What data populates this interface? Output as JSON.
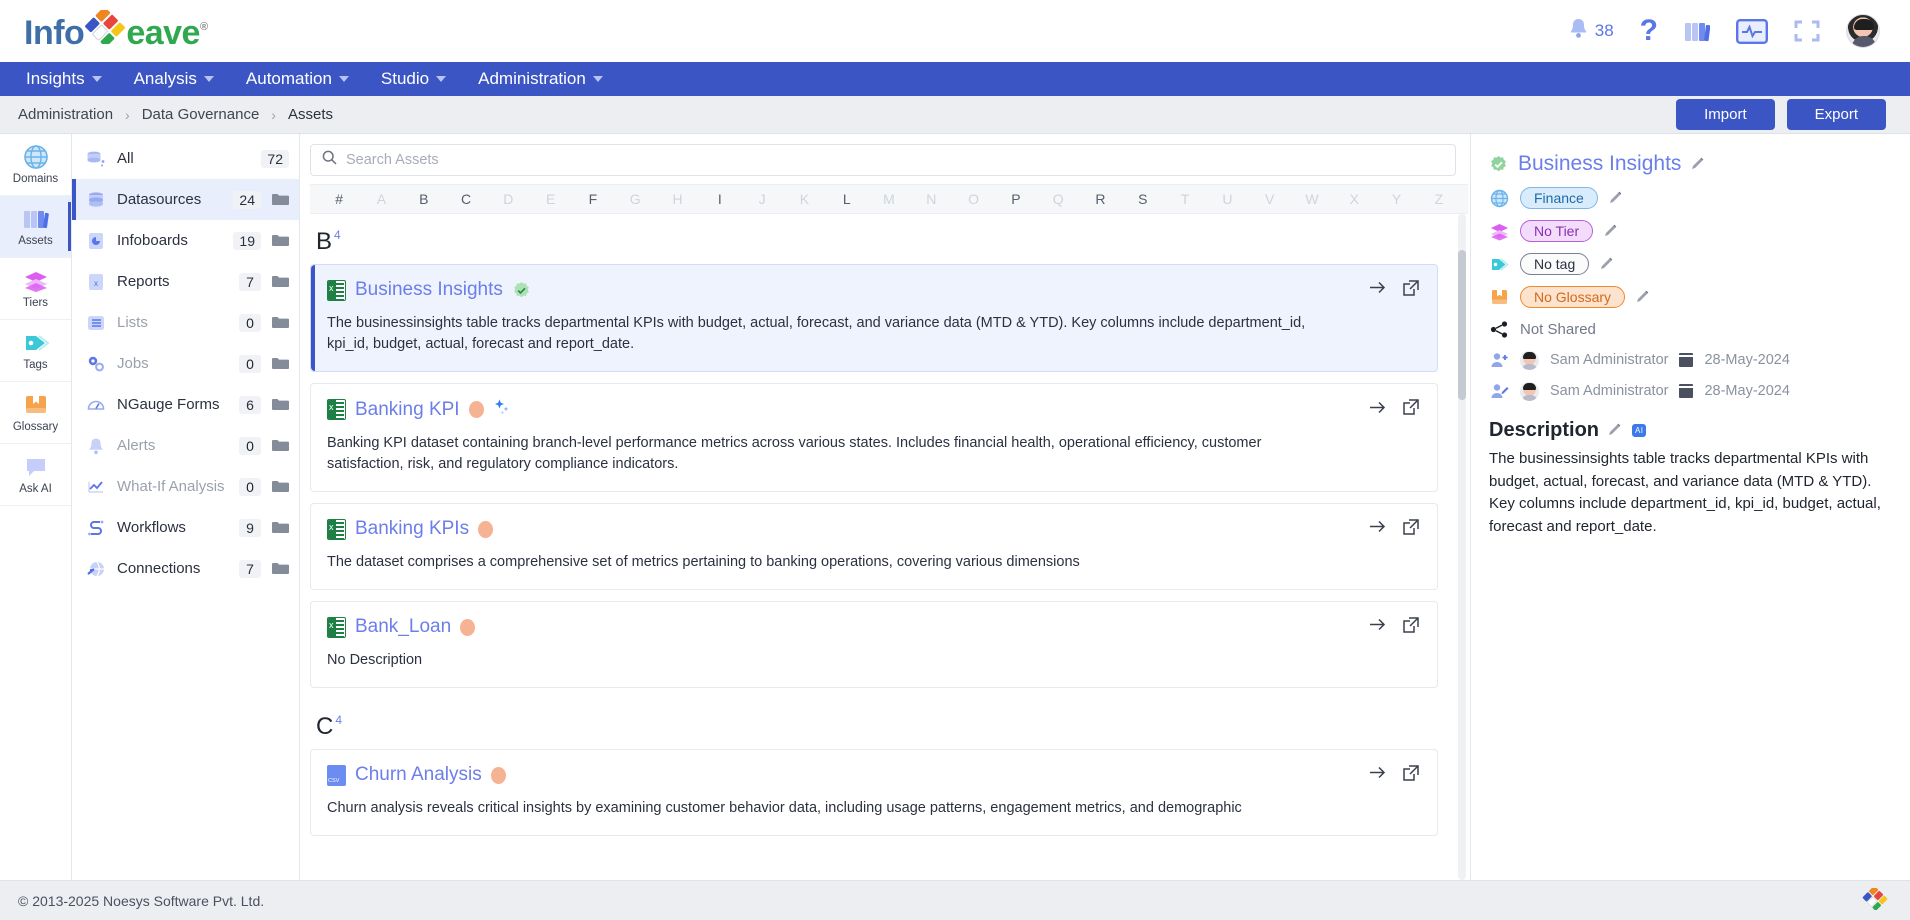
{
  "brand": {
    "name_part1": "Info",
    "name_part2": "eave",
    "reg": "®"
  },
  "header": {
    "notification_count": "38",
    "icons": [
      "bell-icon",
      "help-icon",
      "library-icon",
      "monitor-icon",
      "fullscreen-icon",
      "avatar"
    ]
  },
  "nav": [
    {
      "label": "Insights",
      "has_caret": true
    },
    {
      "label": "Analysis",
      "has_caret": true
    },
    {
      "label": "Automation",
      "has_caret": true
    },
    {
      "label": "Studio",
      "has_caret": true
    },
    {
      "label": "Administration",
      "has_caret": true
    }
  ],
  "breadcrumb": {
    "items": [
      "Administration",
      "Data Governance",
      "Assets"
    ],
    "separator": "›"
  },
  "actions": {
    "import": "Import",
    "export": "Export"
  },
  "rail": [
    {
      "label": "Domains",
      "icon": "globe-icon",
      "active": false
    },
    {
      "label": "Assets",
      "icon": "books-icon",
      "active": true
    },
    {
      "label": "Tiers",
      "icon": "layers-icon",
      "active": false
    },
    {
      "label": "Tags",
      "icon": "tag-icon",
      "active": false
    },
    {
      "label": "Glossary",
      "icon": "book-icon",
      "active": false
    },
    {
      "label": "Ask AI",
      "icon": "chat-icon",
      "active": false
    }
  ],
  "types": [
    {
      "label": "All",
      "count": "72",
      "icon": "database-all-icon",
      "active": false,
      "dim": false,
      "folder": false
    },
    {
      "label": "Datasources",
      "count": "24",
      "icon": "database-icon",
      "active": true,
      "dim": false,
      "folder": true
    },
    {
      "label": "Infoboards",
      "count": "19",
      "icon": "infoboard-icon",
      "active": false,
      "dim": false,
      "folder": true
    },
    {
      "label": "Reports",
      "count": "7",
      "icon": "report-icon",
      "active": false,
      "dim": false,
      "folder": true
    },
    {
      "label": "Lists",
      "count": "0",
      "icon": "list-icon",
      "active": false,
      "dim": true,
      "folder": true
    },
    {
      "label": "Jobs",
      "count": "0",
      "icon": "gears-icon",
      "active": false,
      "dim": true,
      "folder": true
    },
    {
      "label": "NGauge Forms",
      "count": "6",
      "icon": "gauge-icon",
      "active": false,
      "dim": false,
      "folder": true
    },
    {
      "label": "Alerts",
      "count": "0",
      "icon": "bell-icon",
      "active": false,
      "dim": true,
      "folder": true
    },
    {
      "label": "What-If Analysis",
      "count": "0",
      "icon": "trend-icon",
      "active": false,
      "dim": true,
      "folder": true
    },
    {
      "label": "Workflows",
      "count": "9",
      "icon": "workflow-icon",
      "active": false,
      "dim": false,
      "folder": true
    },
    {
      "label": "Connections",
      "count": "7",
      "icon": "connections-icon",
      "active": false,
      "dim": false,
      "folder": true
    }
  ],
  "search": {
    "placeholder": "Search Assets",
    "value": ""
  },
  "alphabet": {
    "letters": [
      "#",
      "A",
      "B",
      "C",
      "D",
      "E",
      "F",
      "G",
      "H",
      "I",
      "J",
      "K",
      "L",
      "M",
      "N",
      "O",
      "P",
      "Q",
      "R",
      "S",
      "T",
      "U",
      "V",
      "W",
      "X",
      "Y",
      "Z"
    ],
    "active": [
      "#",
      "B",
      "C",
      "F",
      "I",
      "L",
      "P",
      "R",
      "S"
    ]
  },
  "groups": [
    {
      "letter": "B",
      "count": "4",
      "assets": [
        {
          "title": "Business Insights",
          "file_icon": "excel-icon",
          "verified": true,
          "has_orange_dot": false,
          "has_ai_sparkle": false,
          "description": "The businessinsights table tracks departmental KPIs with budget, actual, forecast, and variance data (MTD & YTD). Key columns include department_id, kpi_id, budget, actual, forecast and report_date.",
          "selected": true
        },
        {
          "title": "Banking KPI",
          "file_icon": "excel-icon",
          "verified": false,
          "has_orange_dot": true,
          "has_ai_sparkle": true,
          "description": "Banking KPI dataset containing branch-level performance metrics across various states. Includes financial health, operational efficiency, customer satisfaction, risk, and regulatory compliance indicators.",
          "selected": false
        },
        {
          "title": "Banking KPIs",
          "file_icon": "excel-icon",
          "verified": false,
          "has_orange_dot": true,
          "has_ai_sparkle": false,
          "description": "The dataset comprises a comprehensive set of metrics pertaining to banking operations, covering various dimensions",
          "selected": false
        },
        {
          "title": "Bank_Loan",
          "file_icon": "excel-icon",
          "verified": false,
          "has_orange_dot": true,
          "has_ai_sparkle": false,
          "description": "No Description",
          "selected": false
        }
      ]
    },
    {
      "letter": "C",
      "count": "4",
      "assets": [
        {
          "title": "Churn Analysis",
          "file_icon": "csv-icon",
          "verified": false,
          "has_orange_dot": true,
          "has_ai_sparkle": false,
          "description": "Churn analysis reveals critical insights by examining customer behavior data, including usage patterns, engagement metrics, and demographic",
          "selected": false
        }
      ]
    }
  ],
  "detail": {
    "title": "Business Insights",
    "verified": true,
    "domain": {
      "icon": "globe-icon",
      "value": "Finance"
    },
    "tier": {
      "icon": "layers-icon",
      "value": "No Tier"
    },
    "tag": {
      "icon": "tag-icon",
      "value": "No tag"
    },
    "glossary": {
      "icon": "book-icon",
      "value": "No Glossary"
    },
    "shared": {
      "icon": "share-icon",
      "value": "Not Shared"
    },
    "created": {
      "icon": "user-add-icon",
      "user": "Sam Administrator",
      "date": "28-May-2024"
    },
    "modified": {
      "icon": "user-edit-icon",
      "user": "Sam Administrator",
      "date": "28-May-2024"
    },
    "description_heading": "Description",
    "ai_badge": "AI",
    "description": "The businessinsights table tracks departmental KPIs with budget, actual, forecast, and variance data (MTD & YTD). Key columns include department_id, kpi_id, budget, actual, forecast and report_date."
  },
  "footer": {
    "copyright": "© 2013-2025 Noesys Software Pvt. Ltd."
  },
  "colors": {
    "brand_blue": "#3b55c4",
    "link_blue": "#6b7eea",
    "accent_green": "#2fa84f",
    "orange": "#f6b393",
    "selected_bg": "#eef3fe"
  }
}
